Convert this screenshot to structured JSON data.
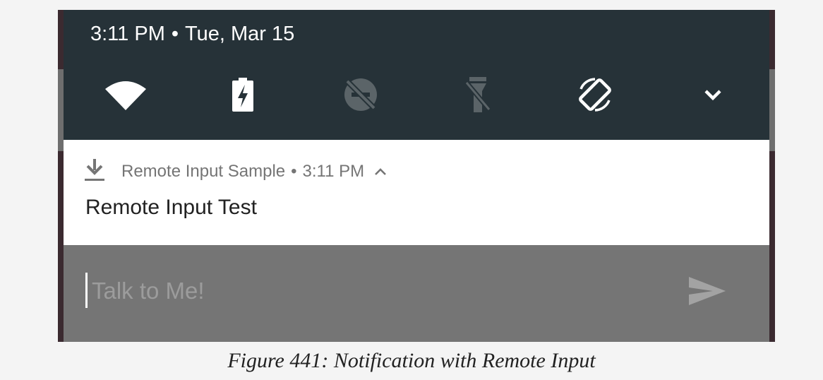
{
  "status_bar": {
    "time": "3:11 PM",
    "separator": "•",
    "date": "Tue, Mar 15"
  },
  "quick_settings": [
    {
      "icon": "wifi-icon",
      "state": "on"
    },
    {
      "icon": "battery-charging-icon",
      "state": "on"
    },
    {
      "icon": "do-not-disturb-off-icon",
      "state": "off"
    },
    {
      "icon": "flashlight-off-icon",
      "state": "off"
    },
    {
      "icon": "auto-rotate-icon",
      "state": "on"
    },
    {
      "icon": "chevron-down-icon",
      "state": "expand"
    }
  ],
  "notification": {
    "app_icon": "download-icon",
    "app_name": "Remote Input Sample",
    "separator": "•",
    "time": "3:11 PM",
    "expand_icon": "chevron-up-icon",
    "title": "Remote Input Test"
  },
  "reply": {
    "placeholder": "Talk to Me!",
    "value": "",
    "send_icon": "send-icon"
  },
  "caption": "Figure 441: Notification with Remote Input",
  "colors": {
    "shade_background": "#263238",
    "notification_background": "#ffffff",
    "reply_background": "#757575",
    "page_background": "#f4f4f4"
  }
}
